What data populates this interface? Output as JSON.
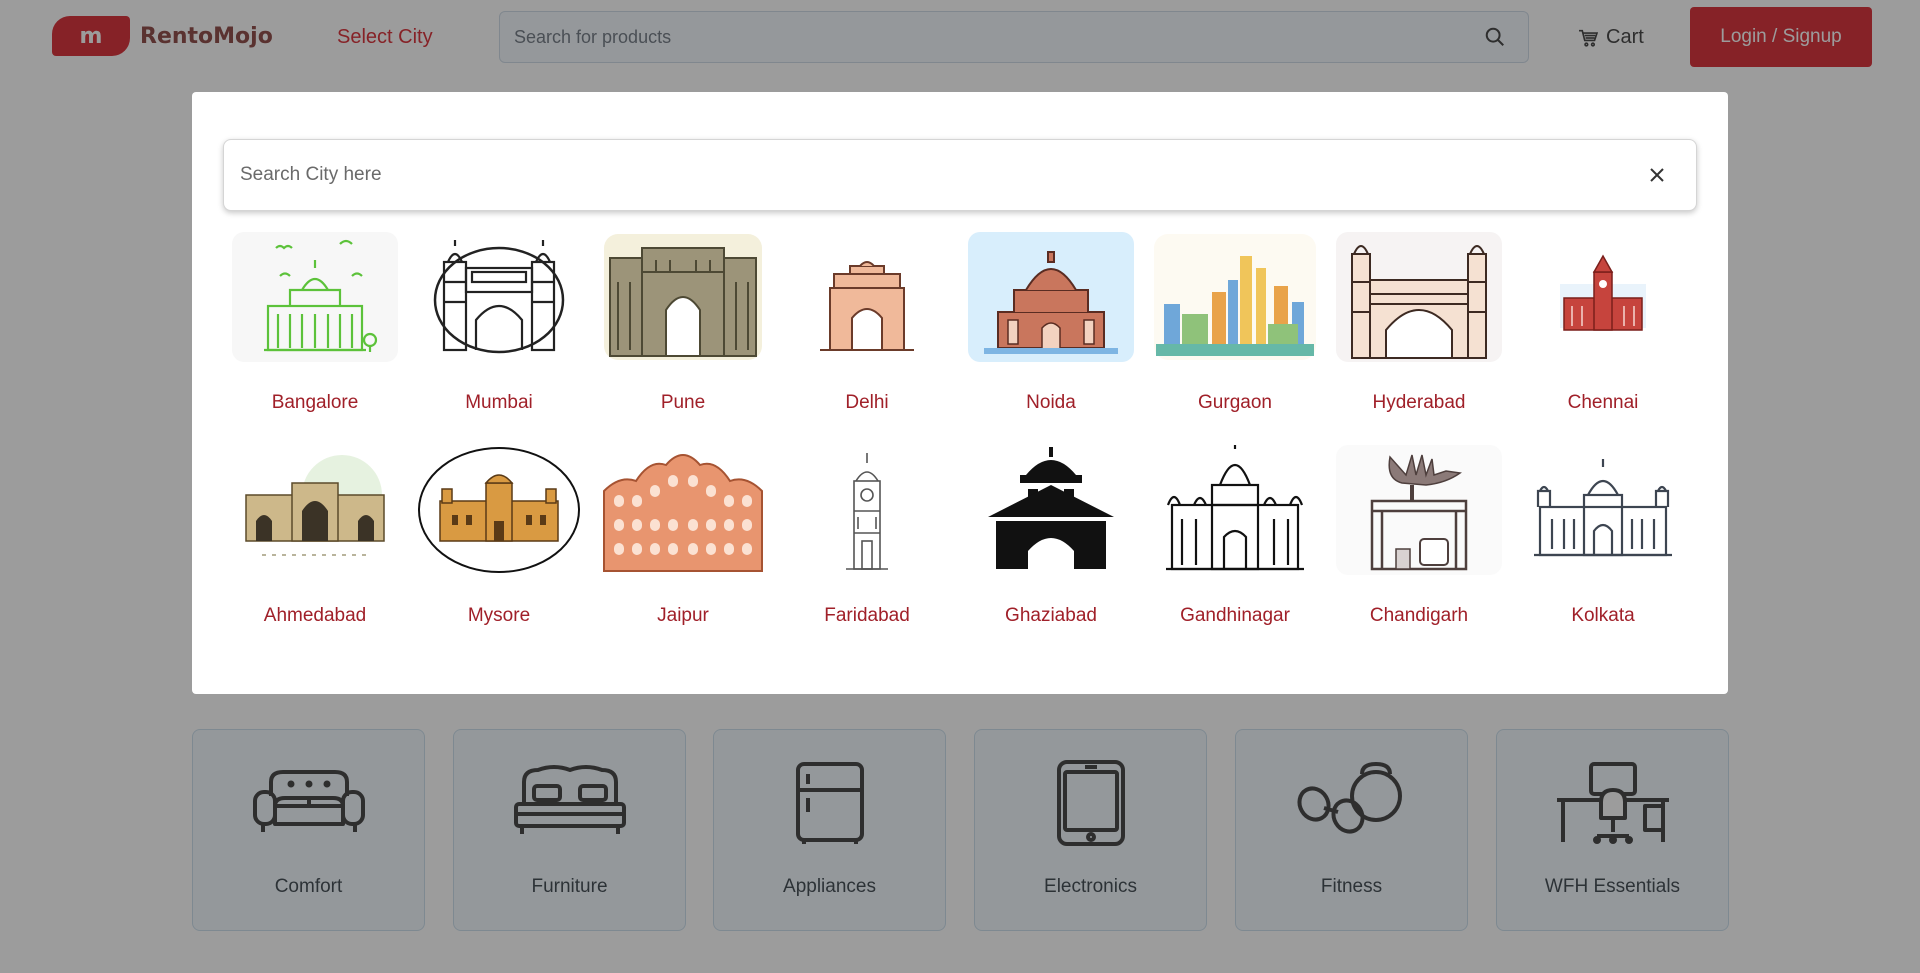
{
  "header": {
    "logo_letter": "m",
    "logo_text": "RentoMojo",
    "select_city": "Select City",
    "search_placeholder": "Search for products",
    "cart_label": "Cart",
    "login_label": "Login / Signup",
    "brand_color": "#d20a14"
  },
  "categories": [
    {
      "label": "Comfort",
      "icon": "sofa-icon"
    },
    {
      "label": "Furniture",
      "icon": "bed-icon"
    },
    {
      "label": "Appliances",
      "icon": "fridge-icon"
    },
    {
      "label": "Electronics",
      "icon": "tablet-icon"
    },
    {
      "label": "Fitness",
      "icon": "dumbbell-icon"
    },
    {
      "label": "WFH Essentials",
      "icon": "desk-chair-icon"
    }
  ],
  "city_modal": {
    "search_placeholder": "Search City here",
    "cities": [
      {
        "name": "Bangalore",
        "icon": "vidhana-soudha-icon"
      },
      {
        "name": "Mumbai",
        "icon": "gateway-of-india-icon"
      },
      {
        "name": "Pune",
        "icon": "shaniwar-wada-icon"
      },
      {
        "name": "Delhi",
        "icon": "india-gate-icon"
      },
      {
        "name": "Noida",
        "icon": "temple-icon"
      },
      {
        "name": "Gurgaon",
        "icon": "skyline-icon"
      },
      {
        "name": "Hyderabad",
        "icon": "charminar-icon"
      },
      {
        "name": "Chennai",
        "icon": "central-station-icon"
      },
      {
        "name": "Ahmedabad",
        "icon": "sidi-saiyyed-mosque-icon"
      },
      {
        "name": "Mysore",
        "icon": "mysore-palace-icon"
      },
      {
        "name": "Jaipur",
        "icon": "hawa-mahal-icon"
      },
      {
        "name": "Faridabad",
        "icon": "clock-tower-icon"
      },
      {
        "name": "Ghaziabad",
        "icon": "monument-icon"
      },
      {
        "name": "Gandhinagar",
        "icon": "palace-icon"
      },
      {
        "name": "Chandigarh",
        "icon": "open-hand-monument-icon"
      },
      {
        "name": "Kolkata",
        "icon": "victoria-memorial-icon"
      }
    ]
  }
}
